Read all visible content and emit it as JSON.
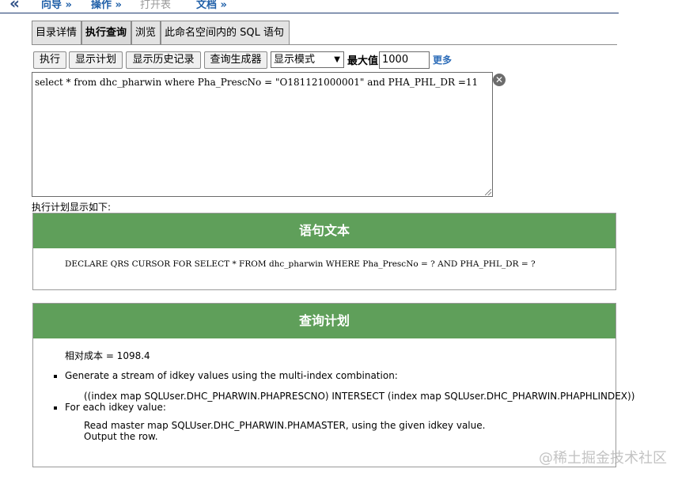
{
  "nav": {
    "links": [
      "向导 »",
      "操作 »",
      "打开表",
      "文档 »"
    ]
  },
  "tabs": [
    "目录详情",
    "执行查询",
    "浏览",
    "此命名空间内的 SQL 语句"
  ],
  "toolbar": {
    "execute": "执行",
    "show_plan": "显示计划",
    "show_history": "显示历史记录",
    "query_builder": "查询生成器",
    "display_mode": "显示模式",
    "max_label": "最大值",
    "max_value": "1000",
    "more": "更多"
  },
  "sql": "select  * from dhc_pharwin where Pha_PrescNo = \"O181121000001\" and PHA_PHL_DR =11",
  "plan_caption": "执行计划显示如下:",
  "statement_panel": {
    "title": "语句文本",
    "text": "DECLARE QRS CURSOR FOR SELECT * FROM dhc_pharwin WHERE Pha_PrescNo = ? AND PHA_PHL_DR = ?"
  },
  "plan_panel": {
    "title": "查询计划",
    "cost": "相对成本 = 1098.4",
    "steps": [
      {
        "text": "Generate a stream of idkey values using the multi-index combination:",
        "details": [
          "((index map SQLUser.DHC_PHARWIN.PHAPRESCNO) INTERSECT (index map SQLUser.DHC_PHARWIN.PHAPHLINDEX))"
        ]
      },
      {
        "text": "For each idkey value:",
        "details": [
          "Read master map SQLUser.DHC_PHARWIN.PHAMASTER, using the given idkey value.",
          "Output the row."
        ]
      }
    ]
  },
  "watermark": "@稀土掘金技术社区",
  "colors": {
    "panel_header": "#5f9f5a",
    "link": "#1f5fa8"
  },
  "icons": [
    "back-chevron-icon",
    "select-caret-icon",
    "clear-icon",
    "resize-grip-icon"
  ]
}
